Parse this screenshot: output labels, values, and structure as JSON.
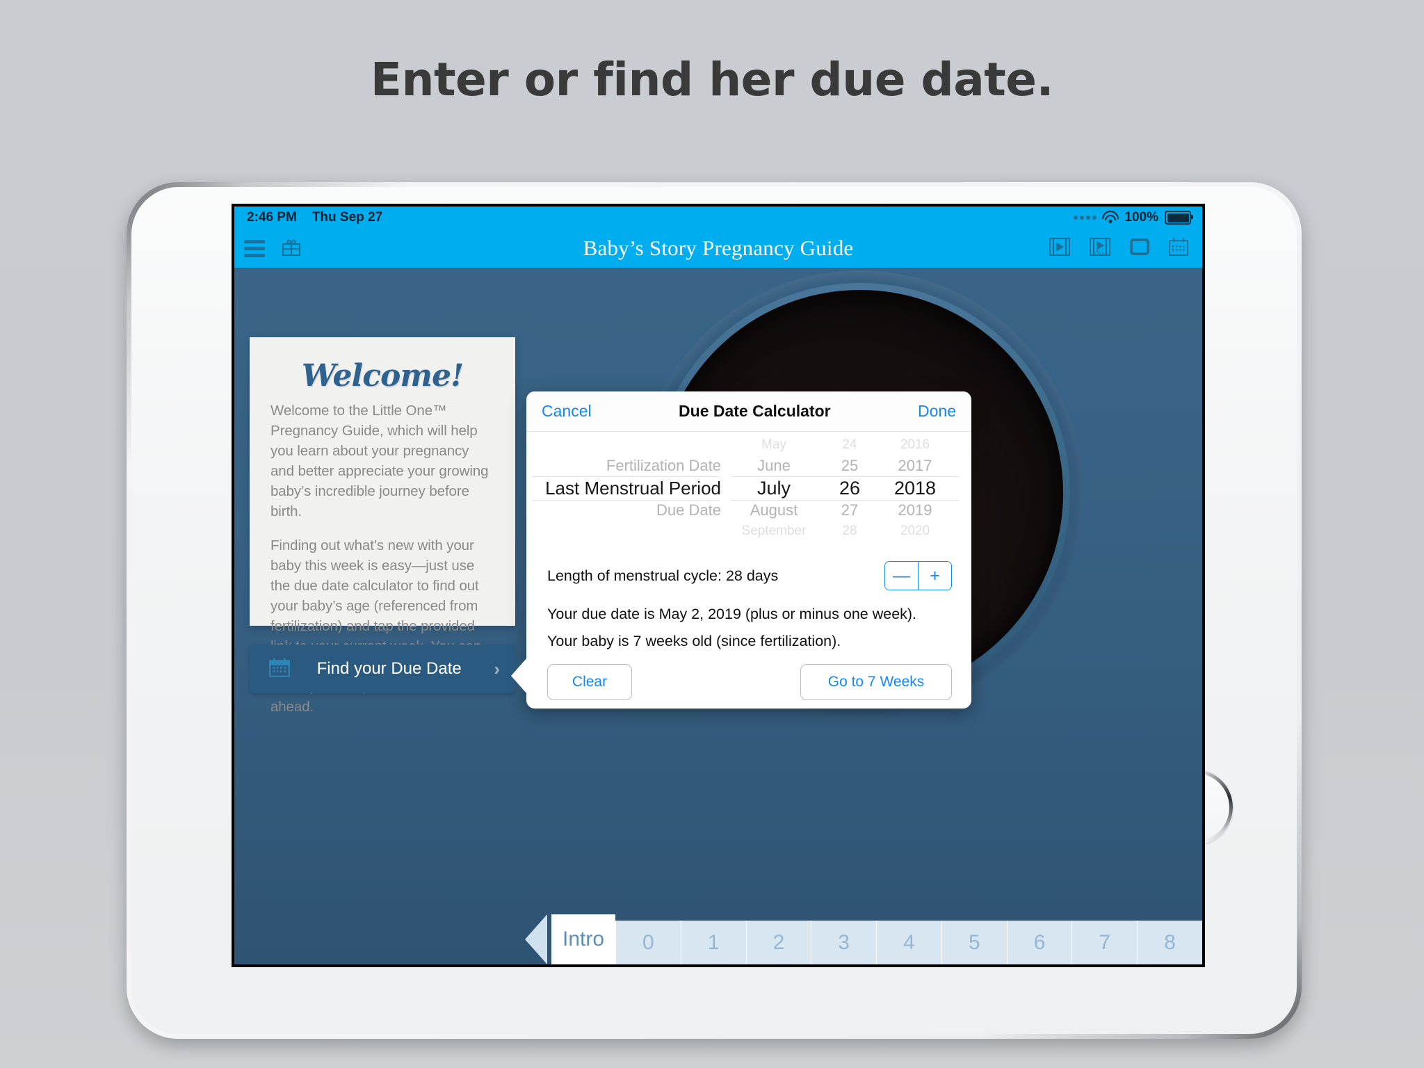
{
  "headline": "Enter or find her due date.",
  "status_bar": {
    "time": "2:46 PM",
    "date": "Thu Sep 27",
    "battery_percent": "100%"
  },
  "nav": {
    "title": "Baby’s Story Pregnancy Guide",
    "left_icons": [
      "menu-icon",
      "gift-icon"
    ],
    "right_icons": [
      "film-play-icon",
      "film-play-all-icon",
      "frame-icon",
      "calendar-icon"
    ],
    "bar_color": "#00aeef"
  },
  "welcome_card": {
    "title": "Welcome!",
    "paragraph1": "Welcome to the Little One™ Pregnancy Guide, which will help you learn about your pregnancy and better appreciate your growing baby’s incredible journey before birth.",
    "paragraph2": "Finding out what’s new with your baby this week is easy—just use the due date calculator to find out your baby’s age (referenced from fertilization) and tap the provided link to your current week. You can also explore what your baby has already accomplished and what lies ahead."
  },
  "find_button": {
    "label": "Find your Due Date",
    "icon": "calendar-icon",
    "chevron": "›"
  },
  "modal": {
    "cancel_label": "Cancel",
    "title": "Due Date Calculator",
    "done_label": "Done",
    "picker": {
      "type_column": {
        "above": "Fertilization Date",
        "selected": "Last Menstrual Period",
        "below": "Due Date"
      },
      "month_column": {
        "rows": [
          "May",
          "June",
          "July",
          "August",
          "September"
        ],
        "selected_index": 2
      },
      "day_column": {
        "rows": [
          "24",
          "25",
          "26",
          "27",
          "28"
        ],
        "selected_index": 2
      },
      "year_column": {
        "rows": [
          "2016",
          "2017",
          "2018",
          "2019",
          "2020"
        ],
        "selected_index": 2
      }
    },
    "cycle": {
      "label": "Length of menstrual cycle:  28 days",
      "value": "28 days",
      "minus_label": "—",
      "plus_label": "+"
    },
    "results": {
      "line1": "Your due date is May 2, 2019 (plus or minus one week).",
      "line2": "Your baby is 7 weeks old (since fertilization)."
    },
    "clear_label": "Clear",
    "goto_label": "Go to 7 Weeks",
    "accent_color": "#1587f5"
  },
  "tabs": {
    "back_arrow": "◀",
    "intro_label": "Intro",
    "numbers": [
      "0",
      "1",
      "2",
      "3",
      "4",
      "5",
      "6",
      "7",
      "8"
    ]
  }
}
